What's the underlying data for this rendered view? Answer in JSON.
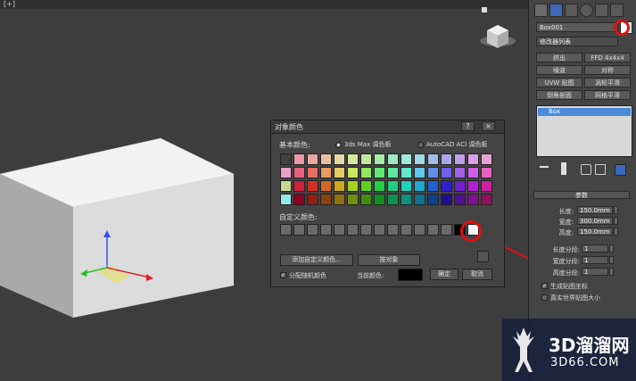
{
  "viewport": {
    "label": "[+]"
  },
  "command_panel": {
    "object_name": "Box001",
    "modifier_list": "修改器列表",
    "modifier_buttons": [
      "挤出",
      "FFD 4x4x4",
      "噪波",
      "对称",
      "UVW 贴图",
      "涡轮平滑",
      "倒角剖面",
      "网格平滑"
    ],
    "stack_item": "Box",
    "rollout_title": "参数",
    "params": [
      {
        "label": "长度:",
        "value": "150.0mm"
      },
      {
        "label": "宽度:",
        "value": "300.0mm"
      },
      {
        "label": "高度:",
        "value": "150.0mm"
      }
    ],
    "segments": [
      {
        "label": "长度分段:",
        "value": "1"
      },
      {
        "label": "宽度分段:",
        "value": "1"
      },
      {
        "label": "高度分段:",
        "value": "1"
      }
    ],
    "checkboxes": [
      {
        "label": "生成贴图坐标",
        "checked": true
      },
      {
        "label": "真实世界贴图大小",
        "checked": false
      }
    ]
  },
  "dialog": {
    "title": "对象颜色",
    "help": "?",
    "close": "×",
    "basic_colors_label": "基本颜色:",
    "radio_3dsmax": "3ds Max 调色板",
    "radio_aci": "AutoCAD ACI 调色板",
    "custom_colors_label": "自定义颜色:",
    "add_custom": "添加自定义颜色...",
    "by_object": "按对象",
    "assign_random": "分配随机颜色",
    "current_color_label": "当前颜色:",
    "ok": "确定",
    "cancel": "取消",
    "current_color": "#000000"
  },
  "palette": [
    [
      "#e89aa8",
      "#e8a8a0",
      "#e8bfa0",
      "#e8d8a0",
      "#d8e8a0",
      "#bfe8a0",
      "#a8e8a8",
      "#a0e8bf",
      "#a0e8d8",
      "#a0d8e8",
      "#a0bfe8",
      "#a8a8e8",
      "#bfa0e8",
      "#d8a0e8",
      "#e8a0d8"
    ],
    [
      "#e86080",
      "#e87060",
      "#e89a60",
      "#e8c860",
      "#c8e860",
      "#90e860",
      "#60e870",
      "#60e8a0",
      "#60e8d0",
      "#60c8e8",
      "#6090e8",
      "#7060e8",
      "#a060e8",
      "#d060e8",
      "#e860c0"
    ],
    [
      "#d02040",
      "#d03020",
      "#d06a20",
      "#d0a820",
      "#a8d020",
      "#60d020",
      "#20d040",
      "#20d080",
      "#20d0c0",
      "#20a8d0",
      "#2060d0",
      "#3020d0",
      "#7020d0",
      "#b020d0",
      "#d020a0"
    ],
    [
      "#900020",
      "#902010",
      "#904010",
      "#907010",
      "#709010",
      "#409010",
      "#109020",
      "#109050",
      "#109080",
      "#107090",
      "#104090",
      "#201090",
      "#501090",
      "#801090",
      "#901060"
    ]
  ],
  "palette_first_col": [
    "#404040",
    "#e8a0c8",
    "#c8d890",
    "#90e8e8"
  ],
  "custom_colors": [
    "#6a6a6a",
    "#6a6a6a",
    "#6a6a6a",
    "#6a6a6a",
    "#6a6a6a",
    "#6a6a6a",
    "#6a6a6a",
    "#6a6a6a",
    "#6a6a6a",
    "#6a6a6a",
    "#6a6a6a",
    "#6a6a6a",
    "#6a6a6a",
    "#000000",
    "#ffffff"
  ],
  "watermark": {
    "line1": "3D溜溜网",
    "line2": "3D66.COM"
  },
  "colors": {
    "highlight_red": "#e01010",
    "stack_selected": "#4a8ad8"
  }
}
